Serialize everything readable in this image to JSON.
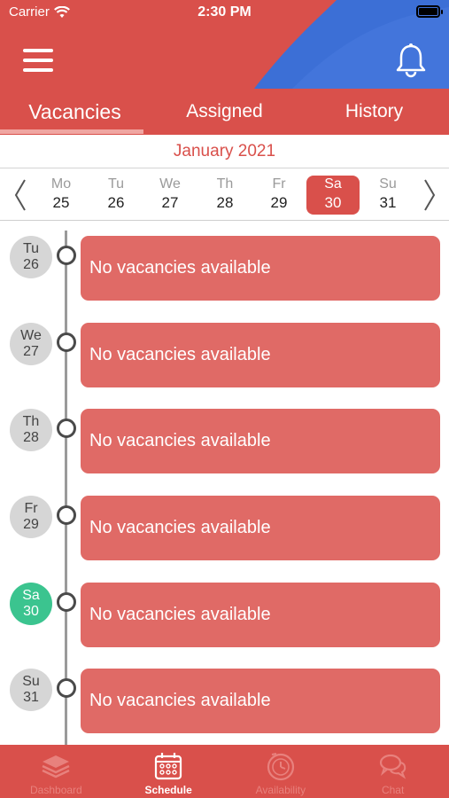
{
  "status_bar": {
    "carrier": "Carrier",
    "time": "2:30 PM"
  },
  "colors": {
    "primary": "#d9504b",
    "card": "#e06a66",
    "accent_blue": "#3c6fd6",
    "today": "#3bc48f"
  },
  "header": {
    "menu_icon": "hamburger-menu-icon",
    "bell_icon": "bell-icon",
    "tabs": [
      {
        "label": "Vacancies",
        "active": true
      },
      {
        "label": "Assigned",
        "active": false
      },
      {
        "label": "History",
        "active": false
      }
    ]
  },
  "calendar": {
    "month": "January 2021",
    "days": [
      {
        "name": "Mo",
        "date": "25"
      },
      {
        "name": "Tu",
        "date": "26"
      },
      {
        "name": "We",
        "date": "27"
      },
      {
        "name": "Th",
        "date": "28"
      },
      {
        "name": "Fr",
        "date": "29"
      },
      {
        "name": "Sa",
        "date": "30",
        "selected": true
      },
      {
        "name": "Su",
        "date": "31"
      }
    ]
  },
  "timeline": [
    {
      "day": "Tu",
      "date": "26",
      "message": "No vacancies available"
    },
    {
      "day": "We",
      "date": "27",
      "message": "No vacancies available"
    },
    {
      "day": "Th",
      "date": "28",
      "message": "No vacancies available"
    },
    {
      "day": "Fr",
      "date": "29",
      "message": "No vacancies available"
    },
    {
      "day": "Sa",
      "date": "30",
      "message": "No vacancies available",
      "today": true
    },
    {
      "day": "Su",
      "date": "31",
      "message": "No vacancies available"
    }
  ],
  "bottom_nav": [
    {
      "label": "Dashboard",
      "icon": "layers-icon"
    },
    {
      "label": "Schedule",
      "icon": "calendar-icon",
      "active": true
    },
    {
      "label": "Availability",
      "icon": "clock-icon"
    },
    {
      "label": "Chat",
      "icon": "chat-bubbles-icon"
    }
  ]
}
